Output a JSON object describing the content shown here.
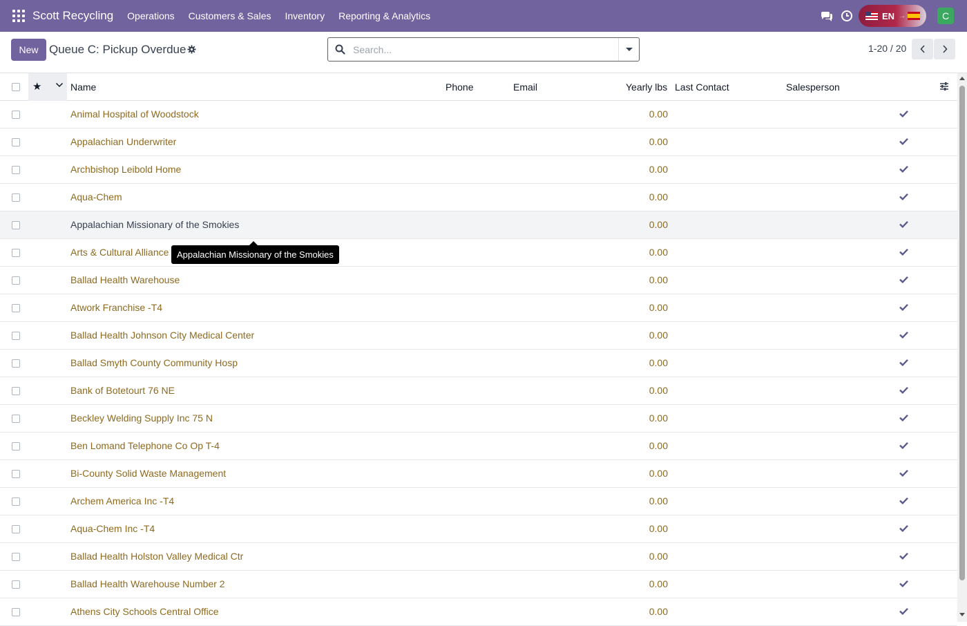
{
  "app": {
    "brand": "Scott Recycling",
    "menu": [
      "Operations",
      "Customers & Sales",
      "Inventory",
      "Reporting & Analytics"
    ],
    "language": "EN",
    "user_initial": "C",
    "accent_color": "#71639e"
  },
  "control_panel": {
    "new_label": "New",
    "title": "Queue C: Pickup Overdue",
    "search_placeholder": "Search...",
    "pager": "1-20 / 20"
  },
  "table": {
    "columns": {
      "name": "Name",
      "phone": "Phone",
      "email": "Email",
      "yearly_lbs": "Yearly lbs",
      "last_contact": "Last Contact",
      "salesperson": "Salesperson"
    },
    "rows": [
      {
        "name": "Animal Hospital of Woodstock",
        "yearly_lbs": "0.00"
      },
      {
        "name": "Appalachian Underwriter",
        "yearly_lbs": "0.00"
      },
      {
        "name": "Archbishop Leibold Home",
        "yearly_lbs": "0.00"
      },
      {
        "name": "Aqua-Chem",
        "yearly_lbs": "0.00"
      },
      {
        "name": "Appalachian Missionary of the Smokies",
        "yearly_lbs": "0.00"
      },
      {
        "name": "Arts & Cultural Alliance",
        "yearly_lbs": "0.00"
      },
      {
        "name": "Ballad Health Warehouse",
        "yearly_lbs": "0.00"
      },
      {
        "name": "Atwork Franchise -T4",
        "yearly_lbs": "0.00"
      },
      {
        "name": "Ballad Health Johnson City Medical Center",
        "yearly_lbs": "0.00"
      },
      {
        "name": "Ballad Smyth County Community Hosp",
        "yearly_lbs": "0.00"
      },
      {
        "name": "Bank of Botetourt 76 NE",
        "yearly_lbs": "0.00"
      },
      {
        "name": "Beckley Welding Supply Inc 75 N",
        "yearly_lbs": "0.00"
      },
      {
        "name": "Ben Lomand Telephone Co Op T-4",
        "yearly_lbs": "0.00"
      },
      {
        "name": "Bi-County Solid Waste Management",
        "yearly_lbs": "0.00"
      },
      {
        "name": "Archem America Inc -T4",
        "yearly_lbs": "0.00"
      },
      {
        "name": "Aqua-Chem Inc -T4",
        "yearly_lbs": "0.00"
      },
      {
        "name": "Ballad Health Holston Valley Medical Ctr",
        "yearly_lbs": "0.00"
      },
      {
        "name": "Ballad Health Warehouse Number 2",
        "yearly_lbs": "0.00"
      },
      {
        "name": "Athens City Schools Central Office",
        "yearly_lbs": "0.00"
      }
    ]
  },
  "tooltip": {
    "text": "Appalachian Missionary of the Smokies"
  }
}
